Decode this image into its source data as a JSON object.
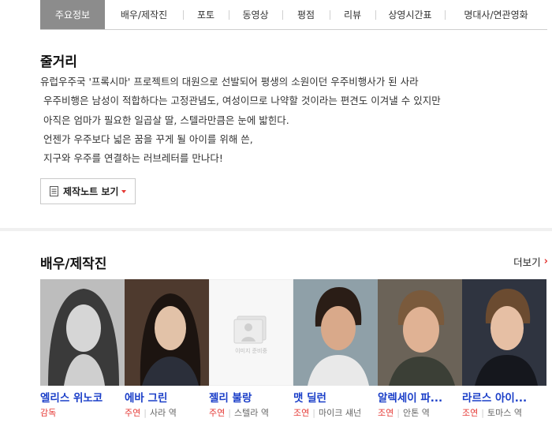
{
  "tabs": [
    {
      "label": "주요정보",
      "active": true
    },
    {
      "label": "배우/제작진"
    },
    {
      "label": "포토"
    },
    {
      "label": "동영상"
    },
    {
      "label": "평점"
    },
    {
      "label": "리뷰"
    },
    {
      "label": "상영시간표"
    },
    {
      "label": "명대사/연관영화"
    }
  ],
  "synopsis": {
    "title": "줄거리",
    "lines": [
      "유럽우주국 '프록시마' 프로젝트의 대원으로 선발되어 평생의 소원이던 우주비행사가 된 사라",
      "우주비행은 남성이 적합하다는 고정관념도, 여성이므로 나약할 것이라는 편견도 이겨낼 수 있지만",
      "아직은 엄마가 필요한 일곱살 딸, 스텔라만큼은 눈에 밟힌다.",
      "언젠가 우주보다 넓은 꿈을 꾸게 될 아이를 위해 쓴,",
      "지구와 우주를 연결하는 러브레터를 만나다!"
    ],
    "notes_button": "제작노트 보기",
    "notes_icon": "document-icon"
  },
  "cast": {
    "title": "배우/제작진",
    "more_label": "더보기",
    "placeholder_text": "이미지 준비중",
    "people": [
      {
        "name": "엘리스 위노코",
        "role_type": "감독",
        "role": ""
      },
      {
        "name": "에바 그린",
        "role_type": "주연",
        "role": "사라 역"
      },
      {
        "name": "젤리 불랑",
        "role_type": "주연",
        "role": "스텔라 역"
      },
      {
        "name": "맷 딜런",
        "role_type": "조연",
        "role": "마이크 섀넌"
      },
      {
        "name": "알렉세이 파...",
        "role_type": "조연",
        "role": "안톤 역"
      },
      {
        "name": "라르스 아이...",
        "role_type": "조연",
        "role": "토마스 역"
      }
    ]
  },
  "colors": {
    "accent": "#e53935",
    "link": "#1a3ec8",
    "active_tab": "#8c8c8c"
  }
}
